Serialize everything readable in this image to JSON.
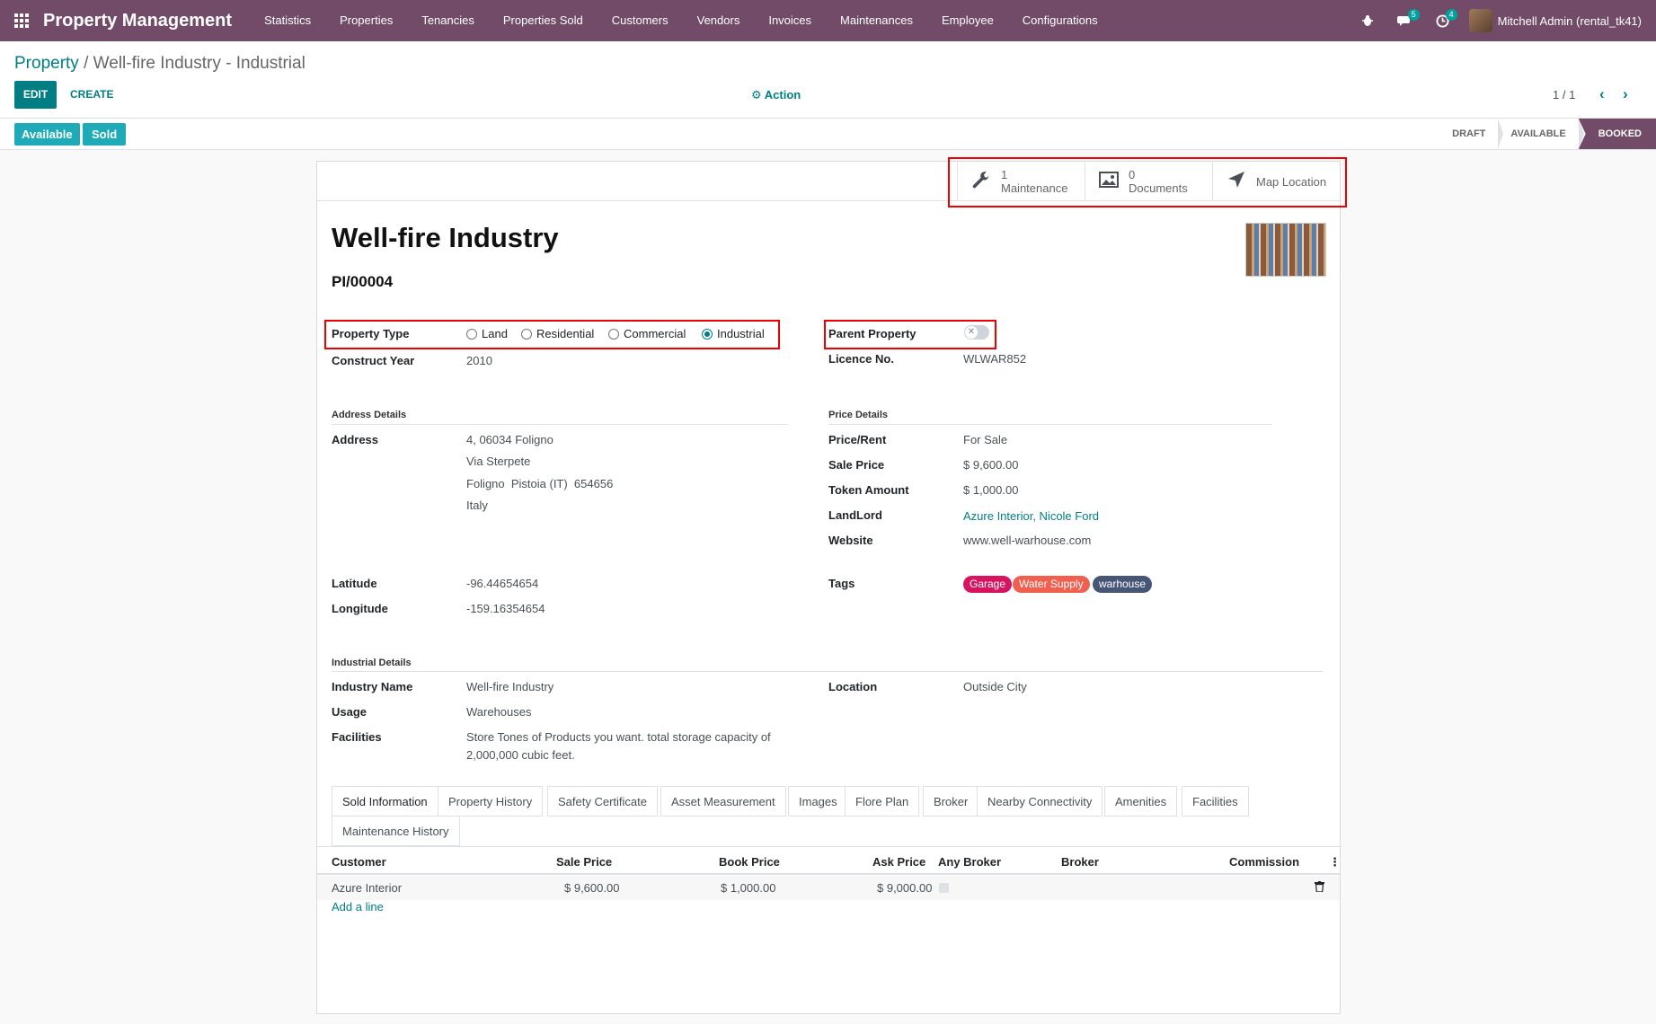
{
  "navbar": {
    "brand": "Property Management",
    "menu": [
      "Statistics",
      "Properties",
      "Tenancies",
      "Properties Sold",
      "Customers",
      "Vendors",
      "Invoices",
      "Maintenances",
      "Employee",
      "Configurations"
    ],
    "messages_count": "5",
    "activities_count": "4",
    "user": "Mitchell Admin (rental_tk41)"
  },
  "control_panel": {
    "breadcrumb_root": "Property",
    "breadcrumb_current": "Well-fire Industry - Industrial",
    "edit_label": "EDIT",
    "create_label": "CREATE",
    "action_label": "Action",
    "pager": "1 / 1",
    "state_buttons": [
      "Available",
      "Sold"
    ],
    "stages": [
      "DRAFT",
      "AVAILABLE",
      "BOOKED"
    ],
    "active_stage": "BOOKED"
  },
  "smart_buttons": {
    "maintenance_count": "1",
    "maintenance_label": "Maintenance",
    "documents_count": "0",
    "documents_label": "Documents",
    "map_label": "Map Location"
  },
  "record": {
    "name": "Well-fire Industry",
    "reference": "PI/00004",
    "property_type_label": "Property Type",
    "property_types": [
      "Land",
      "Residential",
      "Commercial",
      "Industrial"
    ],
    "property_type_selected": "Industrial",
    "parent_property_label": "Parent Property",
    "construct_year_label": "Construct Year",
    "construct_year": "2010",
    "licence_label": "Licence No.",
    "licence": "WLWAR852",
    "address_section": "Address Details",
    "address_label": "Address",
    "address_lines": [
      "4, 06034 Foligno",
      "Via Sterpete",
      "Foligno  Pistoia (IT)  654656",
      "Italy"
    ],
    "latitude_label": "Latitude",
    "latitude": "-96.44654654",
    "longitude_label": "Longitude",
    "longitude": "-159.16354654",
    "price_section": "Price Details",
    "price_rent_label": "Price/Rent",
    "price_rent": "For Sale",
    "sale_price_label": "Sale Price",
    "sale_price": "$ 9,600.00",
    "token_label": "Token Amount",
    "token": "$ 1,000.00",
    "landlord_label": "LandLord",
    "landlord": "Azure Interior, Nicole Ford",
    "website_label": "Website",
    "website": "www.well-warhouse.com",
    "tags_label": "Tags",
    "tags": [
      {
        "name": "Garage",
        "color": "#d6145f"
      },
      {
        "name": "Water Supply",
        "color": "#f06050"
      },
      {
        "name": "warhouse",
        "color": "#475577"
      }
    ],
    "industrial_section": "Industrial Details",
    "industry_name_label": "Industry Name",
    "industry_name": "Well-fire Industry",
    "usage_label": "Usage",
    "usage": "Warehouses",
    "facilities_label": "Facilities",
    "facilities_line1": "Store Tones of Products you want. total storage capacity of",
    "facilities_line2": "2,000,000 cubic feet.",
    "location_label": "Location",
    "location": "Outside City"
  },
  "tabs": [
    "Sold Information",
    "Property History",
    "Safety Certificate",
    "Asset Measurement",
    "Images",
    "Flore Plan",
    "Broker",
    "Nearby Connectivity",
    "Amenities",
    "Facilities",
    "Maintenance History"
  ],
  "sold_table": {
    "headers": [
      "Customer",
      "Sale Price",
      "Book Price",
      "Ask Price",
      "Any Broker",
      "Broker",
      "Commission"
    ],
    "rows": [
      {
        "customer": "Azure Interior",
        "sale_price": "$ 9,600.00",
        "book_price": "$ 1,000.00",
        "ask_price": "$ 9,000.00"
      }
    ],
    "add_line": "Add a line"
  },
  "colors": {
    "brand": "#714b67",
    "accent": "#017e84",
    "state_button": "#1faab8"
  }
}
